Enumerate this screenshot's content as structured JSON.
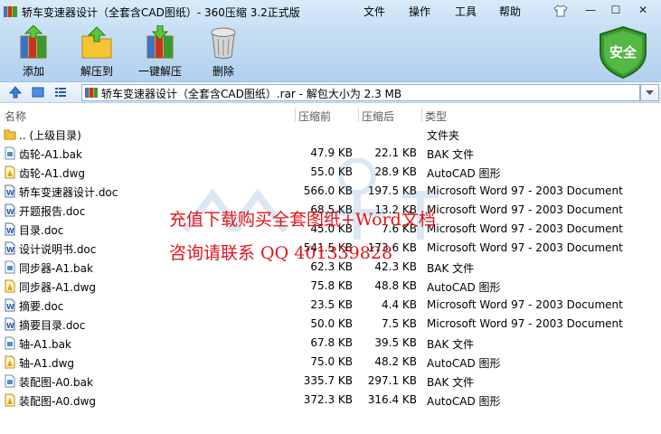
{
  "window": {
    "title": "轿车变速器设计（全套含CAD图纸）- 360压缩 3.2正式版",
    "menu": [
      "文件",
      "操作",
      "工具",
      "帮助"
    ],
    "controls": {
      "minimize": "—",
      "maximize": "☐",
      "close": "✕"
    }
  },
  "toolbar": {
    "add": "添加",
    "extract_to": "解压到",
    "one_click_extract": "一键解压",
    "delete": "删除",
    "security_badge": "安全"
  },
  "address": {
    "path": "轿车变速器设计（全套含CAD图纸）.rar - 解包大小为 2.3 MB"
  },
  "columns": {
    "name": "名称",
    "original_size": "压缩前",
    "packed_size": "压缩后",
    "type": "类型"
  },
  "files": [
    {
      "name": ".. (上级目录)",
      "size": "",
      "packed": "",
      "type": "文件夹",
      "icon": "folder-icon"
    },
    {
      "name": "齿轮-A1.bak",
      "size": "47.9 KB",
      "packed": "22.1 KB",
      "type": "BAK 文件",
      "icon": "bak-file-icon"
    },
    {
      "name": "齿轮-A1.dwg",
      "size": "55.0 KB",
      "packed": "28.9 KB",
      "type": "AutoCAD 图形",
      "icon": "dwg-file-icon"
    },
    {
      "name": "轿车变速器设计.doc",
      "size": "566.0 KB",
      "packed": "197.5 KB",
      "type": "Microsoft Word 97 - 2003 Document",
      "icon": "word-file-icon"
    },
    {
      "name": "开题报告.doc",
      "size": "68.5 KB",
      "packed": "13.2 KB",
      "type": "Microsoft Word 97 - 2003 Document",
      "icon": "word-file-icon"
    },
    {
      "name": "目录.doc",
      "size": "45.0 KB",
      "packed": "7.6 KB",
      "type": "Microsoft Word 97 - 2003 Document",
      "icon": "word-file-icon"
    },
    {
      "name": "设计说明书.doc",
      "size": "541.5 KB",
      "packed": "173.6 KB",
      "type": "Microsoft Word 97 - 2003 Document",
      "icon": "word-file-icon"
    },
    {
      "name": "同步器-A1.bak",
      "size": "62.3 KB",
      "packed": "42.3 KB",
      "type": "BAK 文件",
      "icon": "bak-file-icon"
    },
    {
      "name": "同步器-A1.dwg",
      "size": "75.8 KB",
      "packed": "48.8 KB",
      "type": "AutoCAD 图形",
      "icon": "dwg-file-icon"
    },
    {
      "name": "摘要.doc",
      "size": "23.5 KB",
      "packed": "4.4 KB",
      "type": "Microsoft Word 97 - 2003 Document",
      "icon": "word-file-icon"
    },
    {
      "name": "摘要目录.doc",
      "size": "50.0 KB",
      "packed": "7.5 KB",
      "type": "Microsoft Word 97 - 2003 Document",
      "icon": "word-file-icon"
    },
    {
      "name": "轴-A1.bak",
      "size": "67.8 KB",
      "packed": "39.5 KB",
      "type": "BAK 文件",
      "icon": "bak-file-icon"
    },
    {
      "name": "轴-A1.dwg",
      "size": "75.0 KB",
      "packed": "48.2 KB",
      "type": "AutoCAD 图形",
      "icon": "dwg-file-icon"
    },
    {
      "name": "装配图-A0.bak",
      "size": "335.7 KB",
      "packed": "297.1 KB",
      "type": "BAK 文件",
      "icon": "bak-file-icon"
    },
    {
      "name": "装配图-A0.dwg",
      "size": "372.3 KB",
      "packed": "316.4 KB",
      "type": "AutoCAD 图形",
      "icon": "dwg-file-icon"
    }
  ],
  "watermark": {
    "line1": "充值下载购买全套图纸+Word文档",
    "line2": "咨询请联系 QQ 401339828"
  },
  "colors": {
    "watermark_red": "#e2151b",
    "shield_green": "#3a9a2f",
    "toolbar_blue": "#c3dcf3"
  }
}
